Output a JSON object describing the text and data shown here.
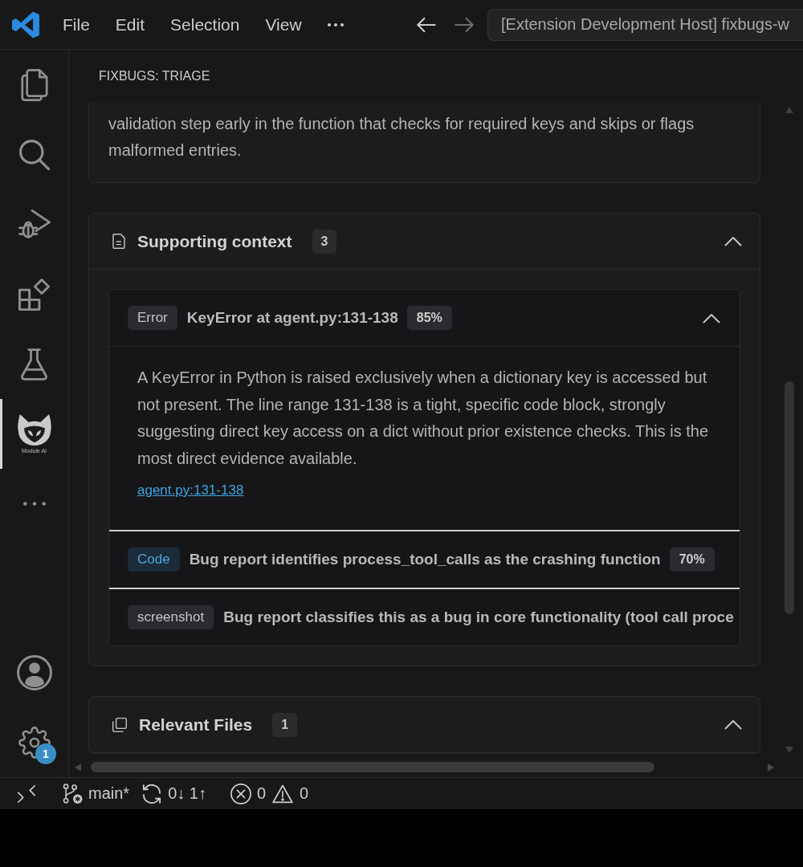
{
  "title_bar": {
    "menu": [
      "File",
      "Edit",
      "Selection",
      "View"
    ],
    "command_center": "[Extension Development Host] fixbugs-w"
  },
  "activity_bar": {
    "items": [
      {
        "kind": "explorer",
        "selected": false
      },
      {
        "kind": "search",
        "selected": false
      },
      {
        "kind": "run-debug",
        "selected": false
      },
      {
        "kind": "extensions",
        "selected": false
      },
      {
        "kind": "testing",
        "selected": false
      },
      {
        "kind": "module-ai",
        "label": "Module AI",
        "selected": true
      }
    ],
    "bottom_items": [
      {
        "kind": "account"
      },
      {
        "kind": "settings",
        "badge": "1"
      }
    ]
  },
  "panel": {
    "title": "FIXBUGS: TRIAGE",
    "summary": "validation step early in the function that checks for required keys and skips or flags malformed entries.",
    "sections": [
      {
        "kind": "context",
        "title": "Supporting context",
        "count": "3",
        "expanded": true,
        "items": [
          {
            "kind": "error",
            "tag": "Error",
            "title": "KeyError at agent.py:131-138",
            "confidence": "85%",
            "expanded": true,
            "body": "A KeyError in Python is raised exclusively when a dictionary key is accessed but not present. The line range 131-138 is a tight, specific code block, strongly suggesting direct key access on a dict without prior existence checks. This is the most direct evidence available.",
            "link": "agent.py:131-138"
          },
          {
            "kind": "code",
            "tag": "Code",
            "title": "Bug report identifies process_tool_calls as the crashing function",
            "confidence": "70%",
            "expanded": false
          },
          {
            "kind": "screenshot",
            "tag": "screenshot",
            "title": "Bug report classifies this as a bug in core functionality (tool call proce",
            "expanded": false
          }
        ]
      },
      {
        "kind": "files",
        "title": "Relevant Files",
        "count": "1",
        "expanded": true
      }
    ]
  },
  "status_bar": {
    "branch": "main*",
    "sync": "0↓ 1↑",
    "errors": "0",
    "warnings": "0"
  }
}
